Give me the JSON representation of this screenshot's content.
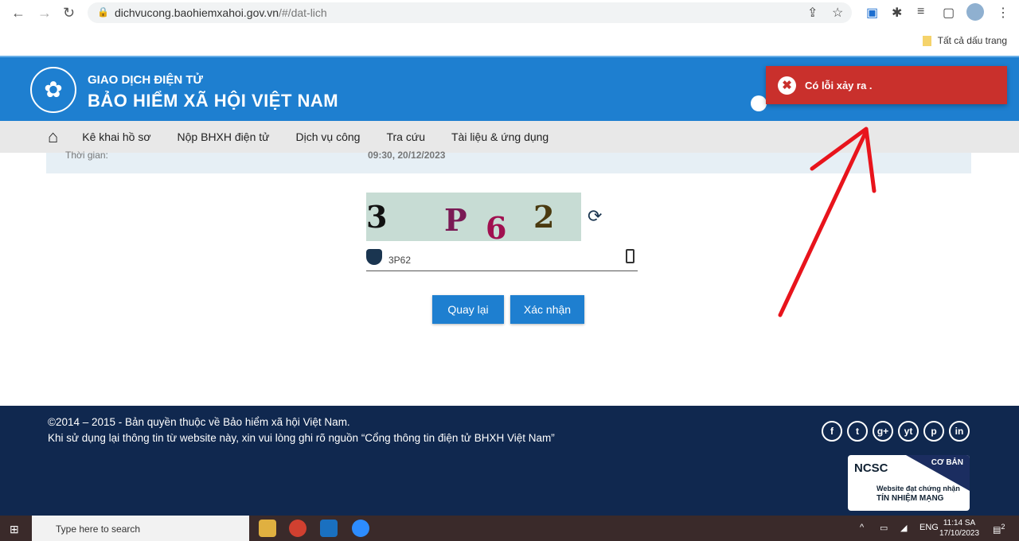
{
  "browser": {
    "url_host": "dichvucong.baohiemxahoi.gov.vn",
    "url_path": "/#/dat-lich",
    "bookmarks_label": "Tất cả dấu trang"
  },
  "header": {
    "line1": "GIAO DỊCH ĐIỆN TỬ",
    "line2": "BẢO HIỂM XÃ HỘI VIỆT NAM"
  },
  "nav": {
    "items": [
      "Kê khai hồ sơ",
      "Nộp BHXH điện tử",
      "Dịch vụ công",
      "Tra cứu",
      "Tài liệu & ứng dụng"
    ]
  },
  "info": {
    "label": "Thời gian:",
    "value": "09:30, 20/12/2023"
  },
  "captcha": {
    "text": "3P62",
    "chars": [
      "3",
      "P",
      "6",
      "2"
    ],
    "input_value": "3P62"
  },
  "buttons": {
    "back": "Quay lại",
    "confirm": "Xác nhận"
  },
  "toast": {
    "message": "Có lỗi xảy ra .",
    "color": "#c9302c"
  },
  "footer": {
    "copyright": "©2014 – 2015 - Bản quyền thuộc về Bảo hiểm xã hội Việt Nam.",
    "notice": "Khi sử dụng lại thông tin từ website này, xin vui lòng ghi rõ nguồn “Cổng thông tin điện tử BHXH Việt Nam”",
    "social": [
      "f",
      "t",
      "g+",
      "yt",
      "p",
      "in"
    ],
    "badge": {
      "brand": "NCSC",
      "level": "CƠ BẢN",
      "line1": "Website đạt chứng nhận",
      "line2": "TÍN NHIỆM MẠNG"
    }
  },
  "taskbar": {
    "search_placeholder": "Type here to search",
    "lang": "ENG",
    "time": "11:14 SA",
    "date": "17/10/2023",
    "notifications": "2"
  }
}
